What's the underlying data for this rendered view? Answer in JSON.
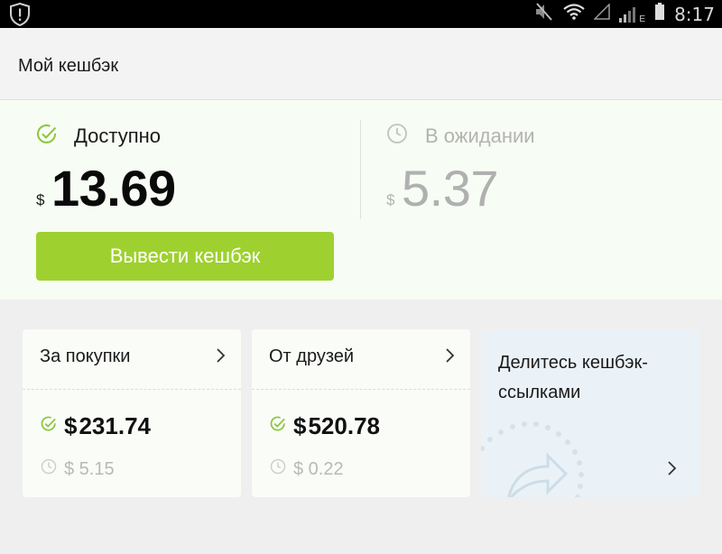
{
  "status_bar": {
    "time": "8:17",
    "network_label": "E"
  },
  "app_bar": {
    "title": "Мой кешбэк"
  },
  "summary": {
    "available": {
      "label": "Доступно",
      "currency": "$",
      "amount": "13.69"
    },
    "pending": {
      "label": "В ожидании",
      "currency": "$",
      "amount": "5.37"
    },
    "withdraw_button": "Вывести кешбэк"
  },
  "cards": [
    {
      "title": "За покупки",
      "available_currency": "$",
      "available_amount": "231.74",
      "pending_amount": "$ 5.15"
    },
    {
      "title": "От друзей",
      "available_currency": "$",
      "available_amount": "520.78",
      "pending_amount": "$ 0.22"
    }
  ],
  "share_card": {
    "title": "Делитесь кешбэк-ссылками"
  },
  "colors": {
    "accent_green": "#9ed12f",
    "muted_gray": "#b9b9b9",
    "status_bar_bg": "#000000"
  },
  "icons": [
    "shield-alert-icon",
    "mute-icon",
    "wifi-icon",
    "signal-icon",
    "battery-icon",
    "check-circle-icon",
    "clock-icon",
    "chevron-right-icon",
    "share-arrow-icon"
  ]
}
